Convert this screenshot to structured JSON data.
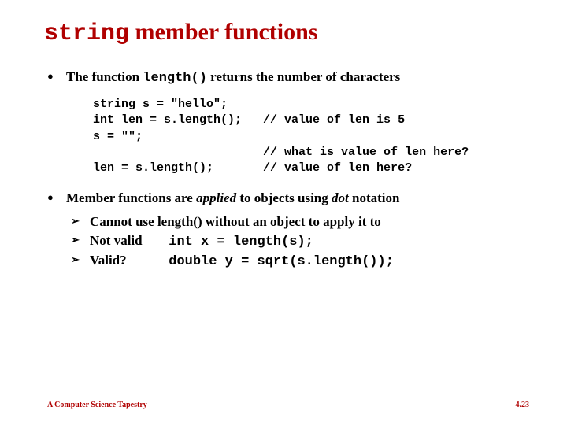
{
  "title": {
    "mono": "string",
    "rest": " member functions"
  },
  "bullet1": {
    "lead1": "The function ",
    "mono": "length()",
    "lead2": " returns the number of characters",
    "code": "string s = \"hello\";\nint len = s.length();   // value of len is 5\ns = \"\";\n                        // what is value of len here?\nlen = s.length();       // value of len here?"
  },
  "bullet2": {
    "t1": "Member functions are ",
    "i1": "applied",
    "t2": " to objects using ",
    "i2": "dot",
    "t3": " notation",
    "sub": {
      "a": "Cannot use length() without an object to apply it to",
      "b_label": "Not valid",
      "b_code": "int x = length(s);",
      "c_label": "Valid?",
      "c_code": "double y = sqrt(s.length());"
    }
  },
  "footer": {
    "left": "A Computer Science Tapestry",
    "right": "4.23"
  }
}
